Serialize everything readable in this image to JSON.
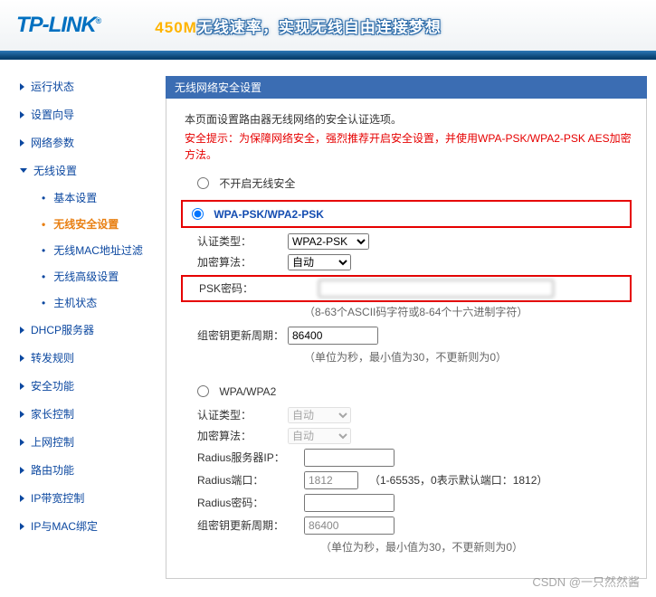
{
  "header": {
    "logo": "TP-LINK",
    "tm": "®",
    "slogan_y": "450M",
    "slogan_w": "无线速率，实现无线自由连接梦想"
  },
  "nav": {
    "items": [
      {
        "label": "运行状态",
        "open": false
      },
      {
        "label": "设置向导",
        "open": false
      },
      {
        "label": "网络参数",
        "open": false
      },
      {
        "label": "无线设置",
        "open": true,
        "subs": [
          {
            "label": "基本设置"
          },
          {
            "label": "无线安全设置",
            "active": true
          },
          {
            "label": "无线MAC地址过滤"
          },
          {
            "label": "无线高级设置"
          },
          {
            "label": "主机状态"
          }
        ]
      },
      {
        "label": "DHCP服务器",
        "open": false
      },
      {
        "label": "转发规则",
        "open": false
      },
      {
        "label": "安全功能",
        "open": false
      },
      {
        "label": "家长控制",
        "open": false
      },
      {
        "label": "上网控制",
        "open": false
      },
      {
        "label": "路由功能",
        "open": false
      },
      {
        "label": "IP带宽控制",
        "open": false
      },
      {
        "label": "IP与MAC绑定",
        "open": false
      }
    ]
  },
  "panel": {
    "title": "无线网络安全设置",
    "intro": "本页面设置路由器无线网络的安全认证选项。",
    "warning": "安全提示：为保障网络安全，强烈推荐开启安全设置，并使用WPA-PSK/WPA2-PSK AES加密方法。",
    "opt_off": "不开启无线安全",
    "wpa_psk": {
      "name": "WPA-PSK/WPA2-PSK",
      "auth_label": "认证类型：",
      "auth_value": "WPA2-PSK",
      "enc_label": "加密算法：",
      "enc_value": "自动",
      "psk_label": "PSK密码：",
      "psk_value": "",
      "psk_hint": "（8-63个ASCII码字符或8-64个十六进制字符）",
      "rekey_label": "组密钥更新周期：",
      "rekey_value": "86400",
      "rekey_hint": "（单位为秒，最小值为30，不更新则为0）"
    },
    "wpa": {
      "name": "WPA/WPA2",
      "auth_label": "认证类型：",
      "auth_value": "自动",
      "enc_label": "加密算法：",
      "enc_value": "自动",
      "radius_ip_label": "Radius服务器IP：",
      "radius_ip_value": "",
      "radius_port_label": "Radius端口：",
      "radius_port_value": "1812",
      "radius_port_hint": "（1-65535，0表示默认端口：1812）",
      "radius_pwd_label": "Radius密码：",
      "radius_pwd_value": "",
      "rekey_label": "组密钥更新周期：",
      "rekey_value": "86400",
      "rekey_hint": "（单位为秒，最小值为30，不更新则为0）"
    }
  },
  "watermark": "CSDN @一只然然酱"
}
